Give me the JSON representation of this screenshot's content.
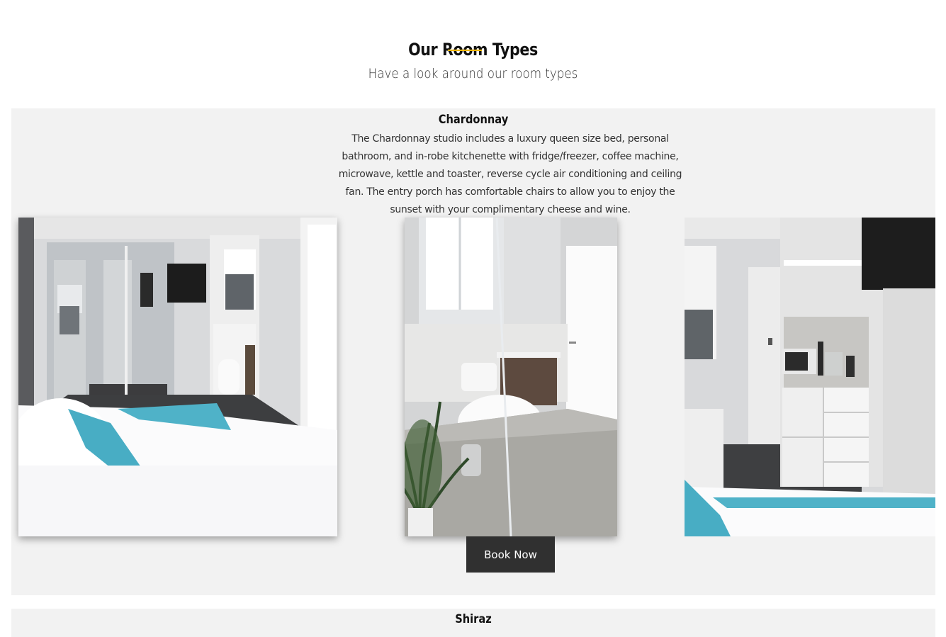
{
  "section": {
    "title": "Our Room Types",
    "subtitle": "Have a look around our room types"
  },
  "rooms": [
    {
      "name": "Chardonnay",
      "description": "The Chardonnay studio includes a luxury queen size bed, personal bathroom, and in-robe kitchenette with fridge/freezer, coffee machine, microwave, kettle and toaster, reverse cycle air conditioning and ceiling fan. The entry porch has comfortable chairs to allow you to enjoy the sunset with your complimentary cheese and wine.",
      "book_label": "Book Now",
      "photos": [
        "bedroom-photo",
        "bathroom-photo",
        "kitchenette-photo"
      ]
    },
    {
      "name": "Shiraz"
    }
  ],
  "colors": {
    "accent": "#f2b705",
    "panel_bg": "#f2f2f2",
    "button_bg": "#303030"
  }
}
